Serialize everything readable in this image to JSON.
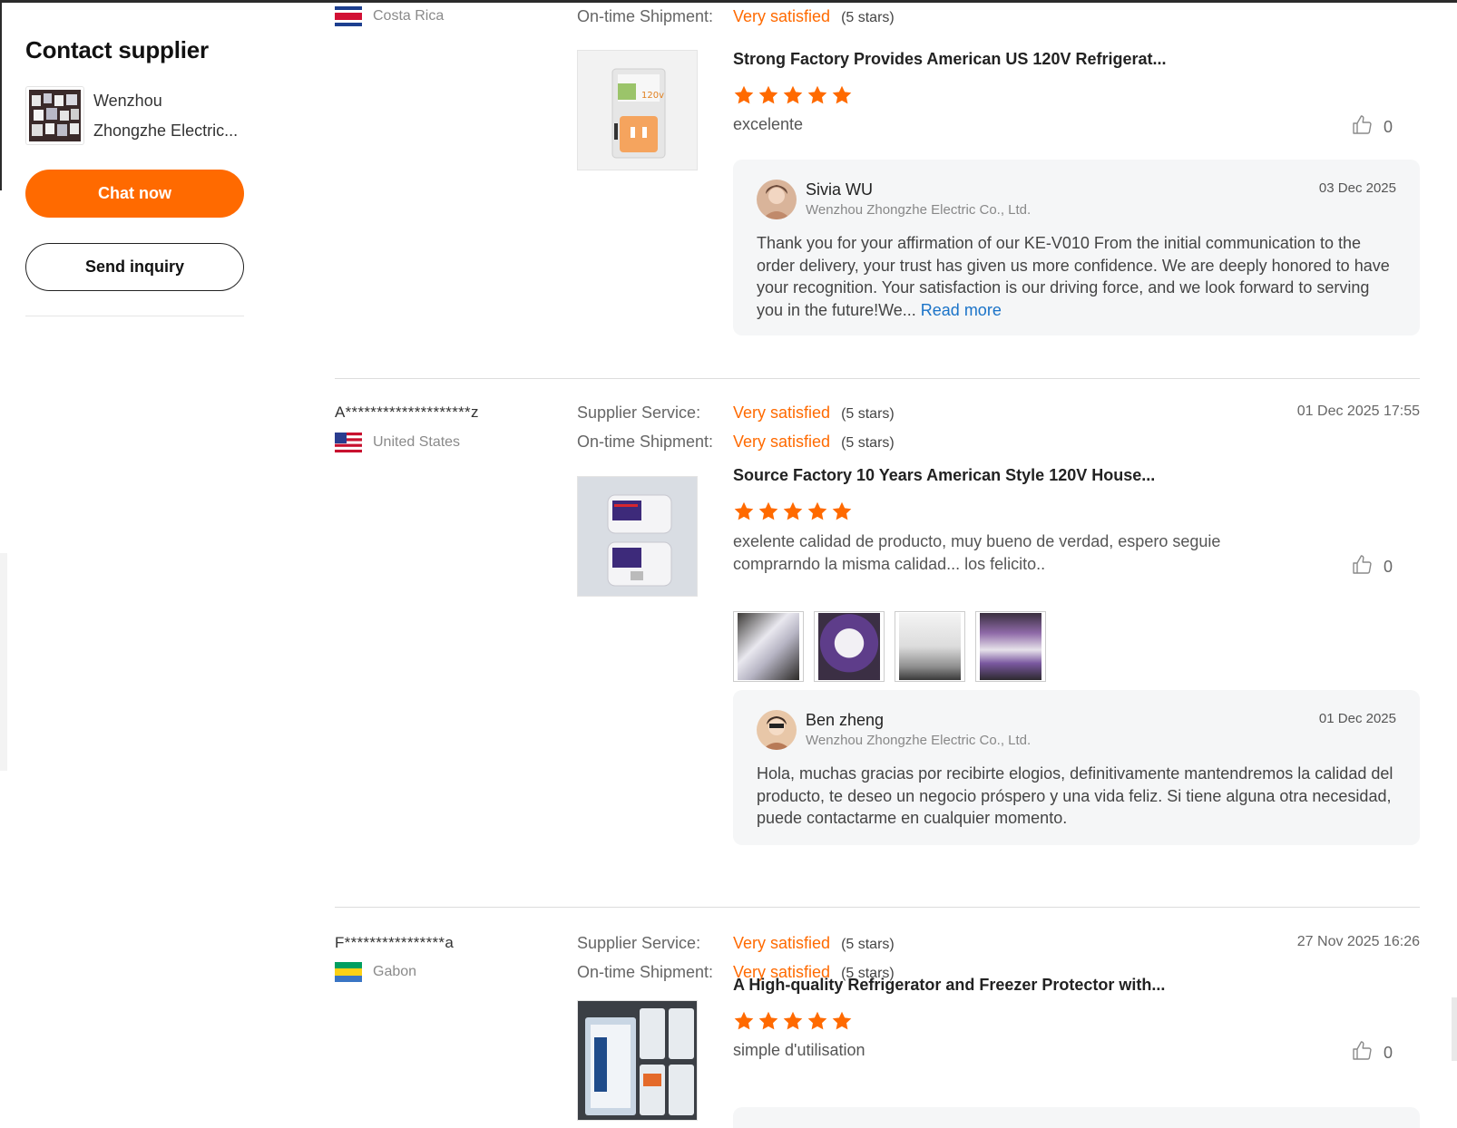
{
  "sidebar": {
    "title": "Contact supplier",
    "supplier_name_line1": "Wenzhou",
    "supplier_name_line2": "Zhongzhe Electric...",
    "chat_label": "Chat now",
    "inquiry_label": "Send inquiry"
  },
  "labels": {
    "supplier_service": "Supplier Service:",
    "ontime_shipment": "On-time Shipment:",
    "read_more": "Read more"
  },
  "reviews": [
    {
      "country": "Costa Rica",
      "shipment_rating": "Very satisfied",
      "shipment_stars": "(5 stars)",
      "product_title": "Strong Factory Provides American US 120V Refrigerat...",
      "stars": 5,
      "comment": "excelente",
      "likes": "0",
      "reply": {
        "name": "Sivia WU",
        "company": "Wenzhou Zhongzhe Electric Co., Ltd.",
        "date": "03 Dec 2025",
        "text": "Thank you for your affirmation of our KE-V010 From the initial communication to the order delivery, your trust has given us more confidence. We are deeply honored to have your recognition. Your satisfaction is our driving force, and we look forward to serving you in the future!We..."
      }
    },
    {
      "buyer": "A********************z",
      "country": "United States",
      "service_rating": "Very satisfied",
      "service_stars": "(5 stars)",
      "shipment_rating": "Very satisfied",
      "shipment_stars": "(5 stars)",
      "date": "01 Dec 2025 17:55",
      "product_title": "Source Factory 10 Years American Style 120V House...",
      "stars": 5,
      "comment": "exelente calidad de producto, muy bueno de verdad, espero seguie comprarndo la misma calidad... los felicito..",
      "likes": "0",
      "reply": {
        "name": "Ben zheng",
        "company": "Wenzhou Zhongzhe Electric Co., Ltd.",
        "date": "01 Dec 2025",
        "text": "Hola, muchas gracias por recibirte elogios, definitivamente mantendremos la calidad del producto, te deseo un negocio próspero y una vida feliz. Si tiene alguna otra necesidad, puede contactarme en cualquier momento."
      }
    },
    {
      "buyer": "F****************a",
      "country": "Gabon",
      "service_rating": "Very satisfied",
      "service_stars": "(5 stars)",
      "shipment_rating": "Very satisfied",
      "shipment_stars": "(5 stars)",
      "date": "27 Nov 2025 16:26",
      "product_title": "A High-quality Refrigerator and Freezer Protector with...",
      "stars": 5,
      "comment": "simple d'utilisation",
      "likes": "0"
    }
  ],
  "colors": {
    "accent": "#ff6a00",
    "link": "#1a73c8"
  }
}
